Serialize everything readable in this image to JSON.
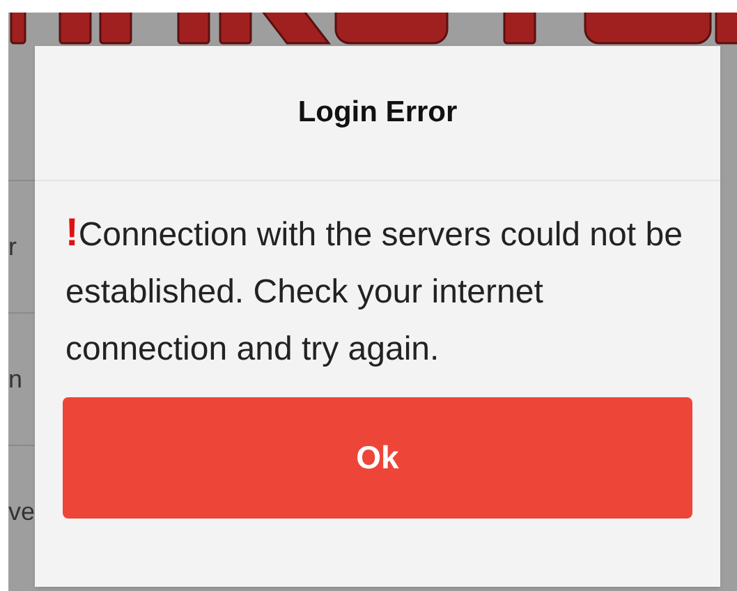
{
  "background": {
    "rows": [
      {
        "label": "r"
      },
      {
        "label": "n"
      },
      {
        "label": "ve"
      }
    ]
  },
  "dialog": {
    "title": "Login Error",
    "icon": "!",
    "message": "Connection with the servers could not be established. Check your internet connection and try again.",
    "button": "Ok"
  }
}
